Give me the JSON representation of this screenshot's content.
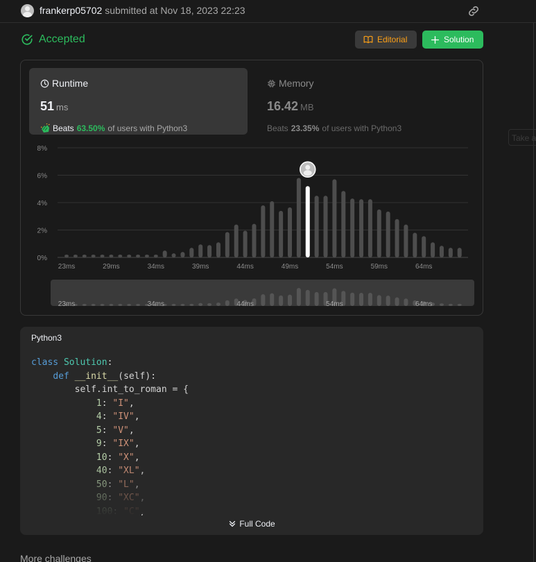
{
  "submission": {
    "username": "frankerp05702",
    "submitted_text": "submitted at Nov 18, 2023 22:23"
  },
  "status": {
    "label": "Accepted",
    "color": "#2cbb5d"
  },
  "buttons": {
    "editorial": "Editorial",
    "solution": "Solution"
  },
  "side_tab_ghost": "Take a",
  "runtime": {
    "title": "Runtime",
    "value": "51",
    "unit": "ms",
    "beats_label": "Beats",
    "beats_pct": "63.50%",
    "beats_rest": "of users with Python3"
  },
  "memory": {
    "title": "Memory",
    "value": "16.42",
    "unit": "MB",
    "beats_label": "Beats",
    "beats_pct": "23.35%",
    "beats_rest": "of users with Python3"
  },
  "chart_data": {
    "type": "bar",
    "ylim": [
      0,
      8
    ],
    "y_ticks": [
      "0%",
      "2%",
      "4%",
      "6%",
      "8%"
    ],
    "x_tick_labels": [
      "23ms",
      "29ms",
      "34ms",
      "39ms",
      "44ms",
      "49ms",
      "54ms",
      "59ms",
      "64ms"
    ],
    "x_tick_bar_index": [
      0,
      5,
      10,
      15,
      20,
      25,
      30,
      35,
      40
    ],
    "values": [
      0.2,
      0.2,
      0.2,
      0.2,
      0.2,
      0.2,
      0.2,
      0.2,
      0.2,
      0.2,
      0.2,
      0.5,
      0.3,
      0.4,
      0.7,
      0.95,
      0.9,
      1.1,
      1.85,
      2.4,
      1.95,
      2.45,
      3.8,
      4.1,
      3.4,
      3.65,
      5.8,
      5.2,
      4.5,
      4.5,
      5.7,
      4.85,
      4.3,
      4.25,
      4.25,
      3.5,
      3.35,
      2.8,
      2.4,
      1.8,
      1.55,
      1.1,
      0.85,
      0.7,
      0.7
    ],
    "highlight_index": 27,
    "grid": true,
    "navigator_tick_labels": [
      "23ms",
      "34ms",
      "44ms",
      "54ms",
      "64ms"
    ]
  },
  "code": {
    "language": "Python3",
    "lines": [
      [
        [
          "kw",
          "class"
        ],
        [
          "",
          " "
        ],
        [
          "cls",
          "Solution"
        ],
        [
          "",
          ":"
        ]
      ],
      [
        [
          "",
          "    "
        ],
        [
          "kw",
          "def"
        ],
        [
          "",
          " "
        ],
        [
          "fn",
          "__init__"
        ],
        [
          "",
          "(self):"
        ]
      ],
      [
        [
          "",
          "        self.int_to_roman = {"
        ]
      ],
      [
        [
          "",
          "            "
        ],
        [
          "num",
          "1"
        ],
        [
          "",
          ": "
        ],
        [
          "str",
          "\"I\""
        ],
        [
          "",
          ","
        ]
      ],
      [
        [
          "",
          "            "
        ],
        [
          "num",
          "4"
        ],
        [
          "",
          ": "
        ],
        [
          "str",
          "\"IV\""
        ],
        [
          "",
          ","
        ]
      ],
      [
        [
          "",
          "            "
        ],
        [
          "num",
          "5"
        ],
        [
          "",
          ": "
        ],
        [
          "str",
          "\"V\""
        ],
        [
          "",
          ","
        ]
      ],
      [
        [
          "",
          "            "
        ],
        [
          "num",
          "9"
        ],
        [
          "",
          ": "
        ],
        [
          "str",
          "\"IX\""
        ],
        [
          "",
          ","
        ]
      ],
      [
        [
          "",
          "            "
        ],
        [
          "num",
          "10"
        ],
        [
          "",
          ": "
        ],
        [
          "str",
          "\"X\""
        ],
        [
          "",
          ","
        ]
      ],
      [
        [
          "",
          "            "
        ],
        [
          "num",
          "40"
        ],
        [
          "",
          ": "
        ],
        [
          "str",
          "\"XL\""
        ],
        [
          "",
          ","
        ]
      ],
      [
        [
          "",
          "            "
        ],
        [
          "num",
          "50"
        ],
        [
          "",
          ": "
        ],
        [
          "str",
          "\"L\""
        ],
        [
          "",
          ","
        ]
      ],
      [
        [
          "",
          "            "
        ],
        [
          "num",
          "90"
        ],
        [
          "",
          ": "
        ],
        [
          "str",
          "\"XC\""
        ],
        [
          "",
          ","
        ]
      ],
      [
        [
          "",
          "            "
        ],
        [
          "num",
          "100"
        ],
        [
          "",
          ": "
        ],
        [
          "str",
          "\"C\""
        ],
        [
          "",
          ","
        ]
      ]
    ],
    "full_code_label": "Full Code"
  },
  "more_challenges": "More challenges"
}
